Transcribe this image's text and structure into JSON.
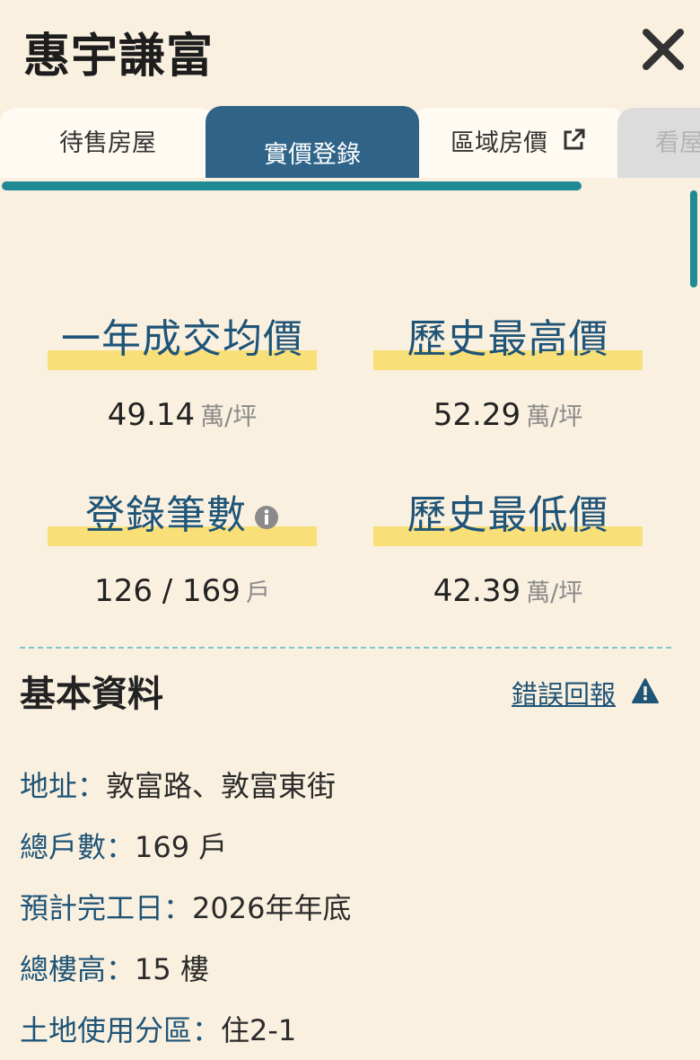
{
  "header": {
    "title": "惠宇謙富"
  },
  "tabs": [
    {
      "label": "待售房屋"
    },
    {
      "label": "實價登錄"
    },
    {
      "label": "區域房價"
    },
    {
      "label": "看屋"
    }
  ],
  "stats": [
    {
      "label": "一年成交均價",
      "value": "49.14",
      "unit": "萬/坪"
    },
    {
      "label": "歷史最高價",
      "value": "52.29",
      "unit": "萬/坪"
    },
    {
      "label": "登錄筆數",
      "value": "126 / 169",
      "unit": "戶"
    },
    {
      "label": "歷史最低價",
      "value": "42.39",
      "unit": "萬/坪"
    }
  ],
  "basic_info": {
    "title": "基本資料",
    "report_link": "錯誤回報",
    "rows": [
      {
        "key": "地址：",
        "value": "敦富路、敦富東街"
      },
      {
        "key": "總戶數：",
        "value": "169 戶"
      },
      {
        "key": "預計完工日：",
        "value": "2026年年底"
      },
      {
        "key": "總樓高：",
        "value": "15 樓"
      },
      {
        "key": "土地使用分區：",
        "value": "住2-1"
      }
    ]
  },
  "icons": {
    "close": "close-icon",
    "external": "external-link-icon",
    "info": "info-icon",
    "warning": "warning-icon"
  },
  "colors": {
    "background": "#faf0e0",
    "active_tab": "#2f6488",
    "accent": "#1f8a94",
    "highlight": "#f9df78",
    "label_blue": "#1e5477"
  }
}
